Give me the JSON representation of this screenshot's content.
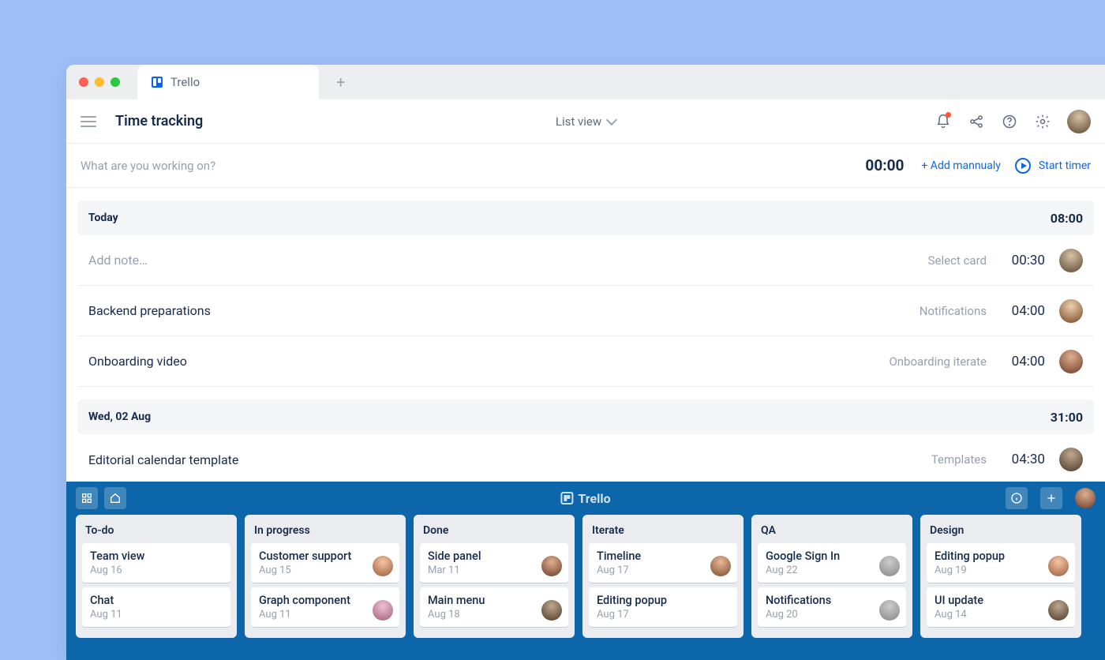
{
  "tab": {
    "label": "Trello"
  },
  "page_title": "Time tracking",
  "view_switch": "List view",
  "work_input_placeholder": "What are you working on?",
  "timer_value": "00:00",
  "add_manually": "+ Add mannualy",
  "start_timer": "Start timer",
  "sections": [
    {
      "label": "Today",
      "total": "08:00",
      "entries": [
        {
          "note": "Add note…",
          "placeholder": true,
          "card": "Select card",
          "time": "00:30",
          "avatar": "av1"
        },
        {
          "note": "Backend preparations",
          "card": "Notifications",
          "time": "04:00",
          "avatar": "av2"
        },
        {
          "note": "Onboarding video",
          "card": "Onboarding iterate",
          "time": "04:00",
          "avatar": "av3"
        }
      ]
    },
    {
      "label": "Wed, 02 Aug",
      "total": "31:00",
      "entries": [
        {
          "note": "Editorial calendar template",
          "card": "Templates",
          "time": "04:30",
          "avatar": "av4"
        }
      ]
    }
  ],
  "board_brand": "Trello",
  "lists": [
    {
      "title": "To-do",
      "cards": [
        {
          "title": "Team view",
          "date": "Aug 16"
        },
        {
          "title": "Chat",
          "date": "Aug 11"
        }
      ]
    },
    {
      "title": "In progress",
      "cards": [
        {
          "title": "Customer support",
          "date": "Aug 15",
          "avatar": "av5"
        },
        {
          "title": "Graph component",
          "date": "Aug 11",
          "avatar": "av8"
        }
      ]
    },
    {
      "title": "Done",
      "cards": [
        {
          "title": "Side panel",
          "date": "Mar 11",
          "avatar": "av3"
        },
        {
          "title": "Main menu",
          "date": "Aug 18",
          "avatar": "av4"
        }
      ]
    },
    {
      "title": "Iterate",
      "cards": [
        {
          "title": "Timeline",
          "date": "Aug 17",
          "avatar": "av6"
        },
        {
          "title": "Editing popup",
          "date": "Aug 17"
        }
      ]
    },
    {
      "title": "QA",
      "cards": [
        {
          "title": "Google Sign In",
          "date": "Aug 22",
          "avatar": "av7"
        },
        {
          "title": "Notifications",
          "date": "Aug 20",
          "avatar": "av7"
        }
      ]
    },
    {
      "title": "Design",
      "cards": [
        {
          "title": "Editing popup",
          "date": "Aug 19",
          "avatar": "av5"
        },
        {
          "title": "UI update",
          "date": "Aug 14",
          "avatar": "av4"
        }
      ]
    }
  ]
}
